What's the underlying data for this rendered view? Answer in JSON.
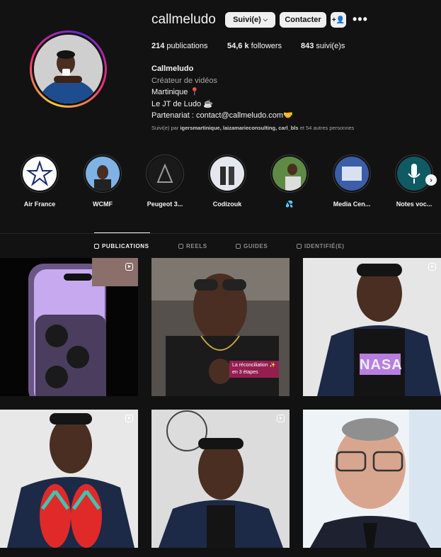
{
  "profile": {
    "username": "callmeludo",
    "following_button": "Suivi(e)",
    "contact_button": "Contacter",
    "stats": {
      "posts_count": "214",
      "posts_label": "publications",
      "followers_count": "54,6 k",
      "followers_label": "followers",
      "following_count": "843",
      "following_label": "suivi(e)s"
    },
    "bio": {
      "name": "Callmeludo",
      "category": "Créateur de vidéos",
      "line1": "Martinique 📍",
      "line2": "Le JT de Ludo ☕",
      "line3": "Partenariat : contact@callmeludo.com🤝"
    },
    "followed_by": {
      "prefix": "Suivi(e) par",
      "names": "igersmartinique, laizamarieconsulting, carl_bls",
      "suffix": "et 54 autres personnes"
    }
  },
  "highlights": [
    {
      "label": "Air France",
      "color": "#ffffff"
    },
    {
      "label": "WCMF",
      "color": "#7fb2e5"
    },
    {
      "label": "Peugeot 3...",
      "color": "#2a2a2a"
    },
    {
      "label": "Codizouk",
      "color": "#dfe6ee"
    },
    {
      "label": "💦",
      "color": "#6a8f4f"
    },
    {
      "label": "Media Cen...",
      "color": "#3b5ea8"
    },
    {
      "label": "Notes voc...",
      "color": "#0f5a63"
    }
  ],
  "tabs": [
    {
      "label": "PUBLICATIONS",
      "active": true
    },
    {
      "label": "REELS",
      "active": false
    },
    {
      "label": "GUIDES",
      "active": false
    },
    {
      "label": "IDENTIFIÉ(E)",
      "active": false
    }
  ],
  "posts": {
    "post2_caption": "La réconciliation ✨ en 3 étapes",
    "post3_shirt_text": "NASA"
  },
  "colors": {
    "background": "#121212",
    "button_bg": "#efefef",
    "secondary_text": "#a8a8a8"
  }
}
